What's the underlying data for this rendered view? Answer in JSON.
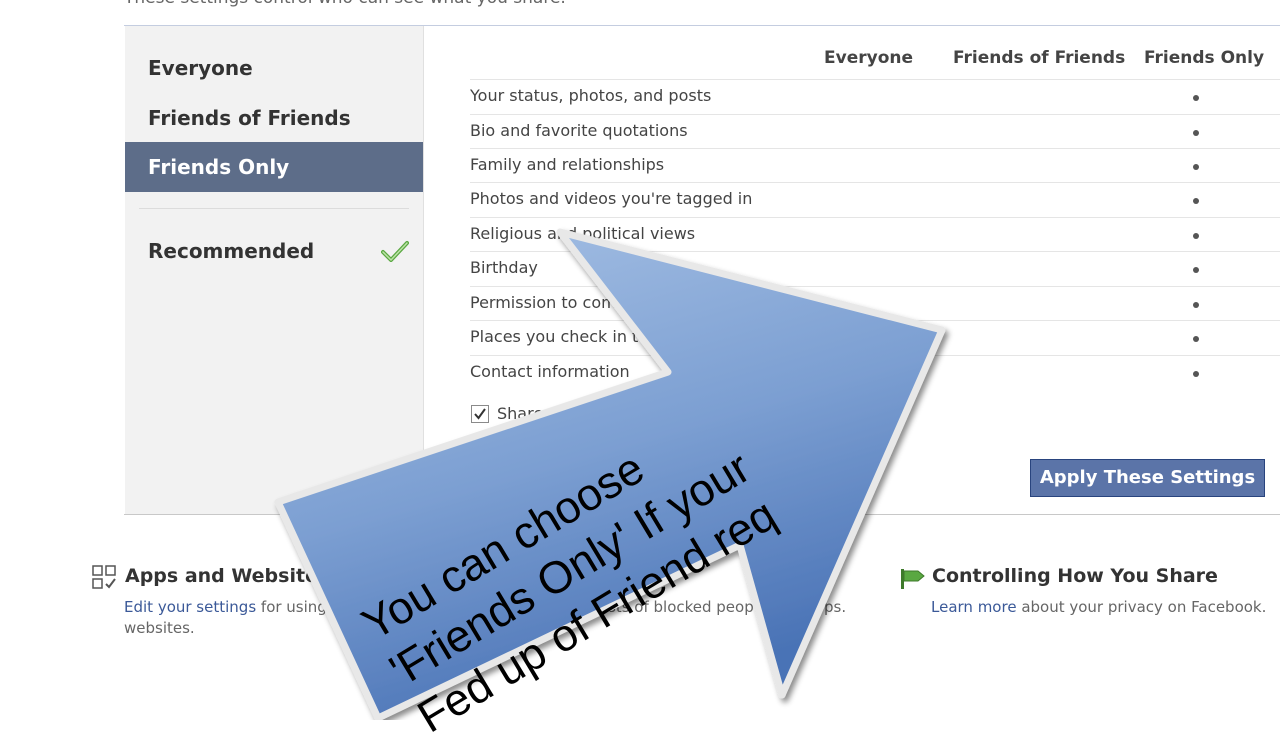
{
  "page": {
    "caption": "These settings control who can see what you share."
  },
  "left_panel": {
    "items": [
      {
        "label": "Everyone"
      },
      {
        "label": "Friends of Friends"
      },
      {
        "label": "Friends Only"
      }
    ],
    "selected": "Friends Only",
    "recommended_label": "Recommended"
  },
  "grid": {
    "headers": [
      "Everyone",
      "Friends of Friends",
      "Friends Only"
    ],
    "rows": [
      {
        "label": "Your status, photos, and posts"
      },
      {
        "label": "Bio and favorite quotations"
      },
      {
        "label": "Family and relationships"
      },
      {
        "label": "Photos and videos you're tagged in"
      },
      {
        "label": "Religious and political views"
      },
      {
        "label": "Birthday"
      },
      {
        "label": "Permission to comm"
      },
      {
        "label": "Places you check in to"
      },
      {
        "label": "Contact information"
      }
    ],
    "share_checkbox_label": "Share",
    "share_checked": true
  },
  "apply_button": {
    "label": "Apply These Settings"
  },
  "footer": {
    "apps": {
      "title": "Apps and Website",
      "link": "Edit your settings",
      "text1": " for using",
      "text2": "websites."
    },
    "blocked": {
      "text": "sts of blocked people"
    },
    "blocked_tail": {
      "text": "ps."
    },
    "controlling": {
      "title": "Controlling How You Share",
      "link": "Learn more",
      "text": " about your privacy on Facebook."
    }
  },
  "overlay": {
    "lines": [
      "You can choose",
      "'Friends Only' If your",
      "Fed up of Friend req"
    ]
  },
  "colors": {
    "selected_bg": "#5d6d89",
    "button_bg": "#5b74a8",
    "link": "#3b5998",
    "arrow_fill_top": "#9fbbe2",
    "arrow_fill_bottom": "#4a73b6"
  }
}
